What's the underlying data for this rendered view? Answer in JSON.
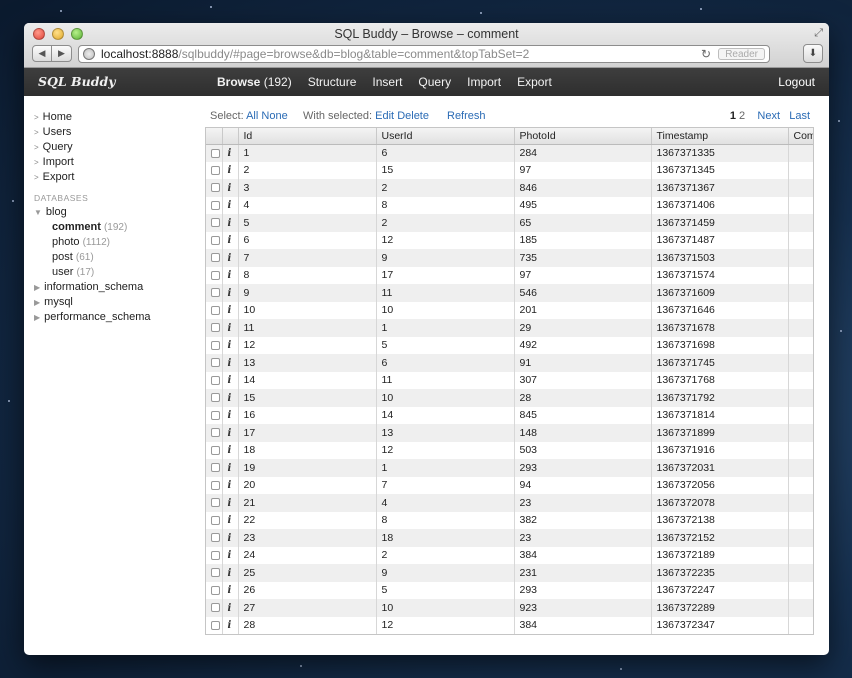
{
  "window": {
    "title": "SQL Buddy – Browse – comment",
    "url_host": "localhost:8888",
    "url_path": "/sqlbuddy/#page=browse&db=blog&table=comment&topTabSet=2",
    "reader_label": "Reader"
  },
  "app": {
    "logo": "SQL Buddy",
    "nav": {
      "browse": "Browse",
      "browse_count": "(192)",
      "structure": "Structure",
      "insert": "Insert",
      "query": "Query",
      "import": "Import",
      "export": "Export"
    },
    "logout": "Logout"
  },
  "sidebar": {
    "items": [
      "Home",
      "Users",
      "Query",
      "Import",
      "Export"
    ],
    "databases_heading": "DATABASES",
    "db_blog": "blog",
    "tables": [
      {
        "name": "comment",
        "count": "(192)"
      },
      {
        "name": "photo",
        "count": "(1112)"
      },
      {
        "name": "post",
        "count": "(61)"
      },
      {
        "name": "user",
        "count": "(17)"
      }
    ],
    "other_dbs": [
      "information_schema",
      "mysql",
      "performance_schema"
    ]
  },
  "toolbar": {
    "select_label": "Select:",
    "all": "All",
    "none": "None",
    "with_selected": "With selected:",
    "edit": "Edit",
    "delete": "Delete",
    "refresh": "Refresh",
    "page_current": "1",
    "page_2": "2",
    "next": "Next",
    "last": "Last"
  },
  "grid": {
    "columns": [
      "Id",
      "UserId",
      "PhotoId",
      "Timestamp",
      "Com"
    ],
    "info_glyph": "i",
    "rows": [
      [
        "1",
        "6",
        "284",
        "1367371335"
      ],
      [
        "2",
        "15",
        "97",
        "1367371345"
      ],
      [
        "3",
        "2",
        "846",
        "1367371367"
      ],
      [
        "4",
        "8",
        "495",
        "1367371406"
      ],
      [
        "5",
        "2",
        "65",
        "1367371459"
      ],
      [
        "6",
        "12",
        "185",
        "1367371487"
      ],
      [
        "7",
        "9",
        "735",
        "1367371503"
      ],
      [
        "8",
        "17",
        "97",
        "1367371574"
      ],
      [
        "9",
        "11",
        "546",
        "1367371609"
      ],
      [
        "10",
        "10",
        "201",
        "1367371646"
      ],
      [
        "11",
        "1",
        "29",
        "1367371678"
      ],
      [
        "12",
        "5",
        "492",
        "1367371698"
      ],
      [
        "13",
        "6",
        "91",
        "1367371745"
      ],
      [
        "14",
        "11",
        "307",
        "1367371768"
      ],
      [
        "15",
        "10",
        "28",
        "1367371792"
      ],
      [
        "16",
        "14",
        "845",
        "1367371814"
      ],
      [
        "17",
        "13",
        "148",
        "1367371899"
      ],
      [
        "18",
        "12",
        "503",
        "1367371916"
      ],
      [
        "19",
        "1",
        "293",
        "1367372031"
      ],
      [
        "20",
        "7",
        "94",
        "1367372056"
      ],
      [
        "21",
        "4",
        "23",
        "1367372078"
      ],
      [
        "22",
        "8",
        "382",
        "1367372138"
      ],
      [
        "23",
        "18",
        "23",
        "1367372152"
      ],
      [
        "24",
        "2",
        "384",
        "1367372189"
      ],
      [
        "25",
        "9",
        "231",
        "1367372235"
      ],
      [
        "26",
        "5",
        "293",
        "1367372247"
      ],
      [
        "27",
        "10",
        "923",
        "1367372289"
      ],
      [
        "28",
        "12",
        "384",
        "1367372347"
      ]
    ]
  }
}
